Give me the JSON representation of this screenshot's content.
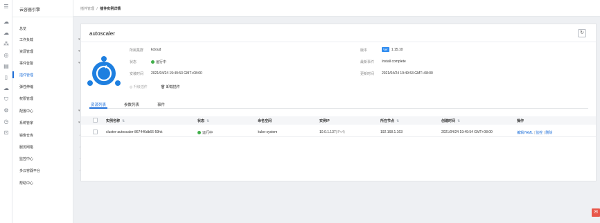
{
  "rail_icons": [
    "menu-icon",
    "cloud-icon",
    "cloud-outline-icon",
    "cluster-icon",
    "database-icon",
    "document-icon",
    "file-icon",
    "cloud-upload-icon",
    "shield-icon",
    "settings-icon",
    "clock-icon",
    "plugin-icon"
  ],
  "sidebar": {
    "brand": "云容器引擎",
    "items": [
      {
        "label": "总览"
      },
      {
        "label": "工作负载",
        "arrow": "▾"
      },
      {
        "label": "资源管理",
        "arrow": "▾"
      },
      {
        "label": "事件告警",
        "arrow": "▾"
      },
      {
        "label": "插件管理"
      },
      {
        "label": "弹性伸缩"
      },
      {
        "label": "权限管理"
      },
      {
        "label": "配置中心",
        "arrow": "▾"
      },
      {
        "label": "系统管家",
        "arrow": "▾"
      },
      {
        "label": "镜像仓库",
        "pin": "↗"
      },
      {
        "label": "服务网格",
        "pin": "↗"
      },
      {
        "label": "监控中心",
        "pin": "↗"
      },
      {
        "label": "多云容器平台",
        "pin": "↗"
      },
      {
        "label": "帮助中心"
      }
    ]
  },
  "breadcrumb": {
    "parent": "插件管理",
    "sep": "/",
    "current": "插件实例详情"
  },
  "plugin": {
    "name": "autoscaler",
    "cluster_label": "所属集群",
    "cluster": "kcloud",
    "status_label": "状态",
    "status": "运行中",
    "install_time_label": "安装时间",
    "install_time": "2021/04/24 19:49:53 GMT+08:00",
    "version_label": "版本",
    "version_badge": "Ver",
    "version": "1.15.10",
    "last_event_label": "最新事件",
    "last_event": "Install complete",
    "update_time_label": "更新时间",
    "update_time": "2021/04/24 19:49:53 GMT+08:00",
    "upgrade_label": "升级插件",
    "uninstall_label": "卸载插件"
  },
  "tabs": [
    "资源列表",
    "参数列表",
    "事件"
  ],
  "table": {
    "headers": [
      "实例名称",
      "状态",
      "命名空间",
      "实例IP",
      "所在节点",
      "创建时间",
      "操作"
    ],
    "rows": [
      {
        "name": "cluster-autoscaler-867446db66-59hk",
        "status": "运行中",
        "namespace": "kube-system",
        "ip": "10.0.1.137",
        "ip_type": "(IPv4)",
        "node": "192.168.1.163",
        "created": "2021/04/24 19:49:54 GMT+08:00",
        "actions": [
          "编辑YAML",
          "监控",
          "删除"
        ]
      }
    ]
  },
  "fab_icon": "feedback-icon"
}
